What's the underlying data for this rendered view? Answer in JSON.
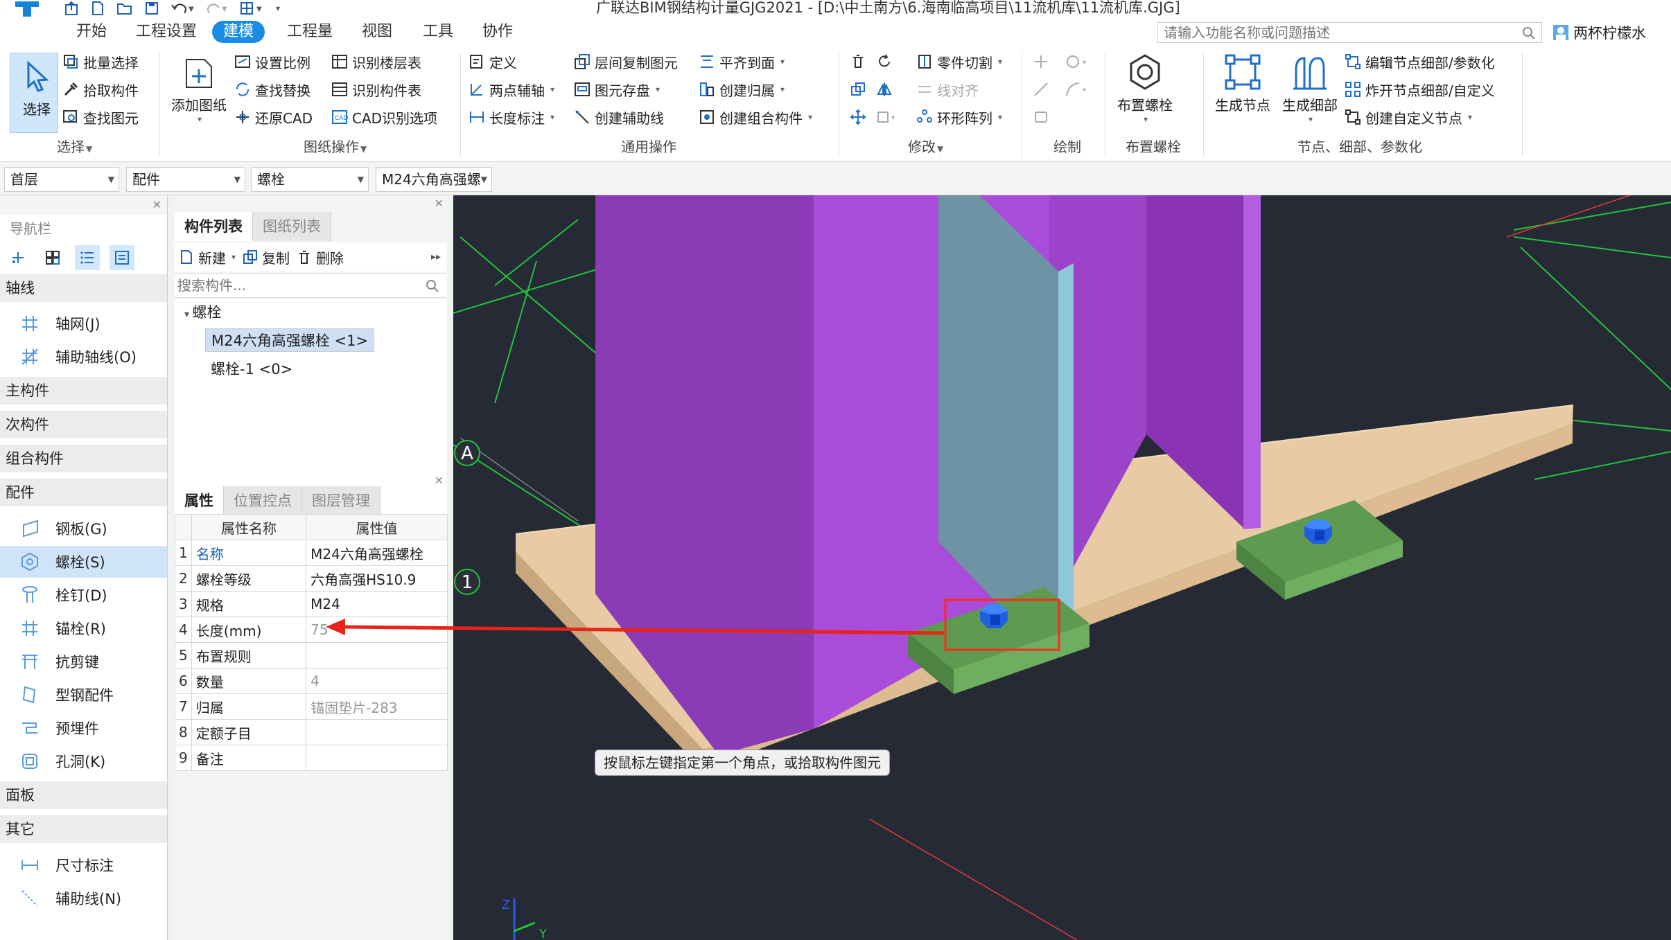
{
  "app": {
    "title": "广联达BIM钢结构计量GJG2021 - [D:\\中土南方\\6.海南临高项目\\11流机库\\11流机库.GJG]"
  },
  "menu": {
    "tabs": [
      "开始",
      "工程设置",
      "建模",
      "工程量",
      "视图",
      "工具",
      "协作"
    ],
    "active": "建模",
    "search_placeholder": "请输入功能名称或问题描述",
    "user": "两杯柠檬水"
  },
  "ribbon": {
    "select": {
      "big": "选择",
      "items": [
        "批量选择",
        "拾取构件",
        "查找图元"
      ],
      "label": "选择"
    },
    "drawing": {
      "big": "添加图纸",
      "items": [
        "设置比例",
        "查找替换",
        "还原CAD",
        "识别楼层表",
        "识别构件表",
        "CAD识别选项"
      ],
      "label": "图纸操作"
    },
    "common": {
      "items": [
        "定义",
        "两点辅轴",
        "长度标注",
        "层间复制图元",
        "图元存盘",
        "创建辅助线",
        "平齐到面",
        "创建归属",
        "创建组合构件"
      ],
      "label": "通用操作"
    },
    "modify": {
      "items": [
        "零件切割",
        "线对齐",
        "环形阵列"
      ],
      "label": "修改"
    },
    "draw": {
      "label": "绘制"
    },
    "bolt": {
      "big": "布置螺栓",
      "label": "布置螺栓"
    },
    "node": {
      "bigs": [
        "生成节点",
        "生成细部"
      ],
      "items": [
        "编辑节点细部/参数化",
        "炸开节点细部/自定义",
        "创建自定义节点"
      ],
      "label": "节点、细部、参数化"
    }
  },
  "selectors": [
    "首层",
    "配件",
    "螺栓",
    "M24六角高强螺"
  ],
  "nav": {
    "title": "导航栏",
    "categories": {
      "axis": "轴线",
      "main": "主构件",
      "secondary": "次构件",
      "combo": "组合构件",
      "fitting": "配件",
      "panel": "面板",
      "other": "其它"
    },
    "axis_items": [
      "轴网(J)",
      "辅助轴线(O)"
    ],
    "fitting_items": [
      "钢板(G)",
      "螺栓(S)",
      "栓钉(D)",
      "锚栓(R)",
      "抗剪键",
      "型钢配件",
      "预埋件",
      "孔洞(K)"
    ],
    "other_items": [
      "尺寸标注",
      "辅助线(N)"
    ]
  },
  "components": {
    "tabs": [
      "构件列表",
      "图纸列表"
    ],
    "toolbar": {
      "new": "新建",
      "copy": "复制",
      "delete": "删除"
    },
    "search_placeholder": "搜索构件...",
    "tree_root": "螺栓",
    "items": [
      "M24六角高强螺栓 <1>",
      "螺栓-1 <0>"
    ]
  },
  "properties": {
    "tabs": [
      "属性",
      "位置控点",
      "图层管理"
    ],
    "header_name": "属性名称",
    "header_value": "属性值",
    "rows": [
      {
        "n": "1",
        "name": "名称",
        "value": "M24六角高强螺栓"
      },
      {
        "n": "2",
        "name": "螺栓等级",
        "value": "六角高强HS10.9"
      },
      {
        "n": "3",
        "name": "规格",
        "value": "M24"
      },
      {
        "n": "4",
        "name": "长度(mm)",
        "value": "75"
      },
      {
        "n": "5",
        "name": "布置规则",
        "value": ""
      },
      {
        "n": "6",
        "name": "数量",
        "value": "4"
      },
      {
        "n": "7",
        "name": "归属",
        "value": "锚固垫片-283"
      },
      {
        "n": "8",
        "name": "定额子目",
        "value": ""
      },
      {
        "n": "9",
        "name": "备注",
        "value": ""
      }
    ]
  },
  "viewport": {
    "axis_labels": [
      "A",
      "1"
    ],
    "axis_indicator": [
      "Z",
      "Y"
    ],
    "tooltip": "按鼠标左键指定第一个角点，或拾取构件图元",
    "colors": {
      "background": "#252a34",
      "column": "#9b3fcb",
      "base_plate": "#d7b68f",
      "washer": "#6fa85f",
      "bolt": "#1f5fe0",
      "highlight": "#ff2a1a",
      "grid": "#22c43a"
    }
  }
}
